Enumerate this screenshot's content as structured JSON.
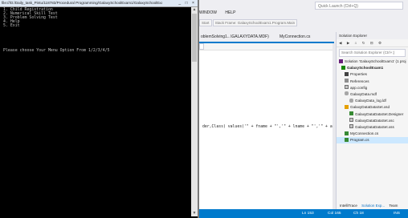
{
  "console": {
    "title": "file:///D:/Daily_task_Pintu/118783/Procedural Programming/GalaxySchoolExam1/GalaxySchoolExa...",
    "window_buttons": [
      "_",
      "□",
      "×"
    ],
    "menu": [
      "1. Child Registration",
      "2. Numerical Skill Test",
      "3. Problem Solving Test",
      "4. Help",
      "5. Exit"
    ],
    "prompt": "Please choose Your Menu Option From 1/2/3/4/5"
  },
  "vs": {
    "quick_launch": "Quick Launch (Ctrl+Q)",
    "menu": [
      "WINDOW",
      "HELP"
    ],
    "toolbar_start": "Start",
    "toolbar_frame": "Stack Frame: GalaxySchoolExam1.Program.Main",
    "doc_tabs": [
      "oblemSolving1...\\GALAXYDATA.MDF)",
      "MyConnection.cs"
    ],
    "code_line": {
      "prefix": "der,Class) values('\" + fname + \"','\" + lname + \"','\" + age +"
    },
    "solution_explorer": {
      "title": "Solution Explorer",
      "search_placeholder": "Search Solution Explorer (Ctrl+;)",
      "items": [
        {
          "label": "Solution 'GalaxySchoolExam1' (1 proj",
          "icon": "solution-icon"
        },
        {
          "label": "GalaxySchoolExam1",
          "icon": "csharp-project-icon"
        },
        {
          "label": "Properties",
          "icon": "wrench-icon"
        },
        {
          "label": "References",
          "icon": "references-icon"
        },
        {
          "label": "app.config",
          "icon": "config-file-icon"
        },
        {
          "label": "GalaxyData.mdf",
          "icon": "database-icon"
        },
        {
          "label": "GalaxyData_log.ldf",
          "icon": "database-log-icon"
        },
        {
          "label": "GalaxyDataDataSet.xsd",
          "icon": "dataset-icon"
        },
        {
          "label": "GalaxyDataDataSet.Designer",
          "icon": "code-file-icon"
        },
        {
          "label": "GalaxyDataDataSet.xsc",
          "icon": "file-icon"
        },
        {
          "label": "GalaxyDataDataSet.xss",
          "icon": "file-icon"
        },
        {
          "label": "MyConnection.cs",
          "icon": "csharp-file-icon"
        },
        {
          "label": "Program.cs",
          "icon": "csharp-file-icon"
        }
      ],
      "bottom_tabs": [
        "IntelliTrace",
        "Solution Exp...",
        "Team Expl..."
      ]
    },
    "status": {
      "line": "Ln 153",
      "col": "Col 165",
      "ch": "Ch 18",
      "mode": "INS"
    }
  },
  "colors": {
    "console_bg": "#000000",
    "console_text": "#c0c0c0",
    "status_bar": "#007acc",
    "selection": "#cce8ff"
  }
}
